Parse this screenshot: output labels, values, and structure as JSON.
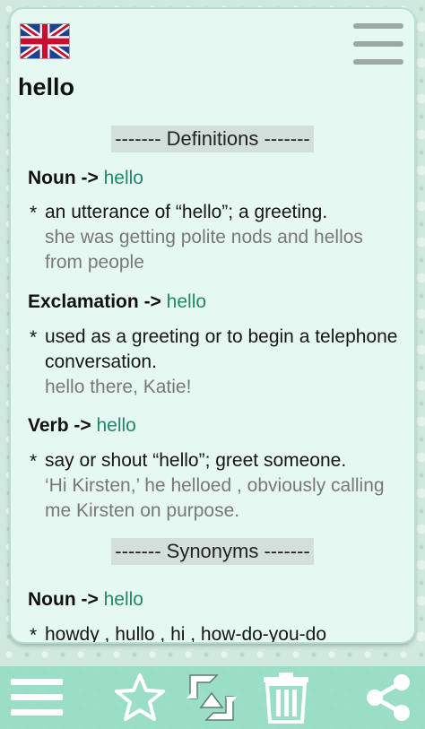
{
  "word": "hello",
  "language_flag": "uk-flag",
  "sections": {
    "definitions": "------- Definitions -------",
    "synonyms": "------- Synonyms -------"
  },
  "definitions": [
    {
      "pos": "Noun",
      "arrow": "->",
      "word": "hello",
      "text": "an utterance of “hello”; a greeting.",
      "example": "she was getting polite nods and hellos from people"
    },
    {
      "pos": "Exclamation",
      "arrow": "->",
      "word": "hello",
      "text": "used as a greeting or to begin a telephone conversation.",
      "example": "hello there, Katie!"
    },
    {
      "pos": "Verb",
      "arrow": "->",
      "word": "hello",
      "text": "say or shout “hello”; greet someone.",
      "example": "‘Hi Kirsten,’ he helloed , obviously calling me Kirsten on purpose."
    }
  ],
  "synonyms": [
    {
      "pos": "Noun",
      "arrow": "->",
      "word": "hello",
      "text": "howdy , hullo , hi , how-do-you-do"
    }
  ],
  "bullet": "*",
  "toolbar": {
    "icons": [
      "menu-icon",
      "star-icon",
      "swap-icon",
      "trash-icon",
      "share-icon"
    ]
  },
  "colors": {
    "accent_green": "#22876a",
    "example_gray": "#787878",
    "card_bg": "#e6f8f2",
    "toolbar_bg": "#96dcc3"
  }
}
